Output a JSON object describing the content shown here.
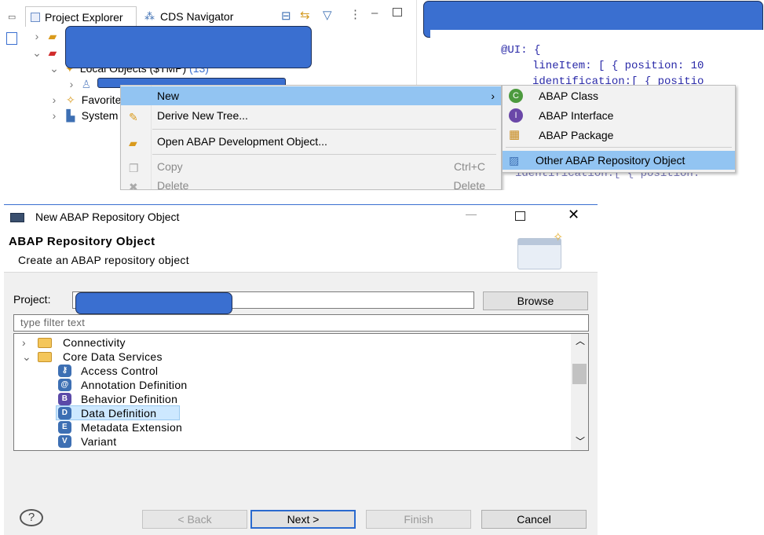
{
  "explorer": {
    "tab_project_explorer": "Project Explorer",
    "tab_cds_navigator": "CDS Navigator",
    "tree": {
      "local_objects": "Local Objects ($TMP)",
      "local_objects_count": "(13)",
      "favorites": "Favorite",
      "system": "System"
    }
  },
  "editor": {
    "lines": [
      "@UI: {",
      "lineItem: [ { position: 10",
      "identification:[ { positio",
      "identification:[ { position:"
    ]
  },
  "context_menu": {
    "new": "New",
    "derive_new_tree": "Derive New Tree...",
    "open_abap_object": "Open ABAP Development Object...",
    "copy": "Copy",
    "copy_key": "Ctrl+C",
    "delete": "Delete",
    "delete_key": "Delete"
  },
  "submenu": {
    "abap_class": "ABAP Class",
    "abap_interface": "ABAP Interface",
    "abap_package": "ABAP Package",
    "other": "Other ABAP Repository Object"
  },
  "dialog": {
    "title": "New ABAP Repository Object",
    "heading": "ABAP Repository Object",
    "subheading": "Create an ABAP repository object",
    "project_label": "Project:",
    "browse": "Browse",
    "filter_placeholder": "type filter text",
    "tree": {
      "connectivity": "Connectivity",
      "core_data_services": "Core Data Services",
      "items": [
        "Access Control",
        "Annotation Definition",
        "Behavior Definition",
        "Data Definition",
        "Metadata Extension",
        "Variant"
      ]
    },
    "buttons": {
      "back": "< Back",
      "next": "Next >",
      "finish": "Finish",
      "cancel": "Cancel"
    },
    "help": "?"
  },
  "colors": {
    "redaction": "#3a6fd0",
    "menu_highlight": "#92c4f2",
    "selection": "#cde8ff"
  }
}
